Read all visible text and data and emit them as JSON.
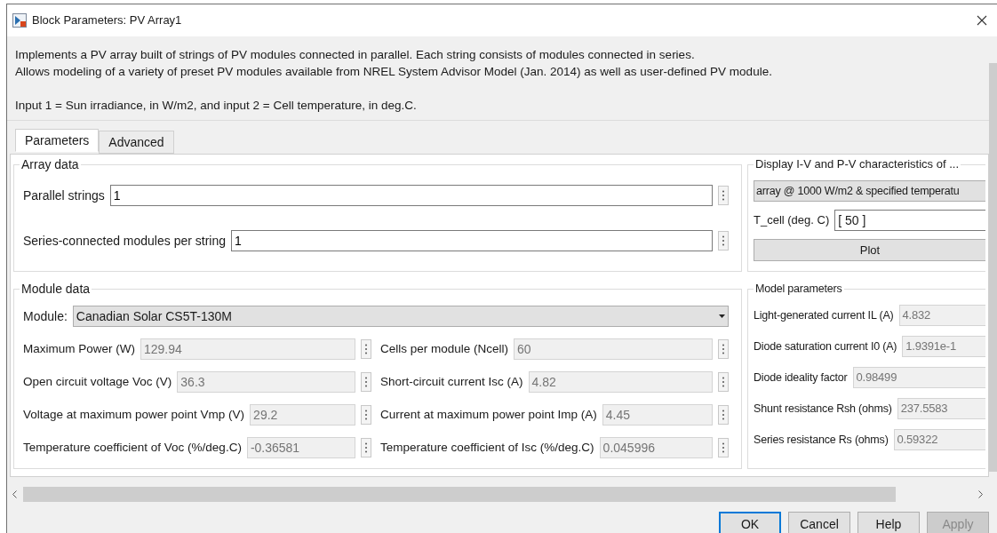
{
  "window": {
    "title": "Block Parameters: PV Array1"
  },
  "description": [
    "Implements a PV array built of strings of PV modules connected in parallel. Each string consists of modules connected in series.",
    "Allows modeling of a variety of preset PV modules available from NREL System Advisor Model (Jan. 2014) as well as user-defined PV module.",
    "Input 1 = Sun irradiance, in W/m2, and input 2 = Cell temperature, in deg.C."
  ],
  "tabs": [
    {
      "label": "Parameters",
      "selected": true
    },
    {
      "label": "Advanced",
      "selected": false
    }
  ],
  "array_data": {
    "title": "Array data",
    "fields": [
      {
        "label": "Parallel strings",
        "value": "1",
        "disabled": false
      },
      {
        "label": "Series-connected modules per string",
        "value": "1",
        "disabled": false
      }
    ]
  },
  "display": {
    "title": "Display  I-V and P-V characteristics of ...",
    "selection": "array @ 1000 W/m2 & specified temperatu",
    "t_cell_label": "T_cell (deg. C)",
    "t_cell_value": "[ 50 ]",
    "plot_button": "Plot"
  },
  "module_data": {
    "title": "Module data",
    "module_label": "Module:",
    "module_value": "Canadian Solar CS5T-130M",
    "rows": [
      [
        {
          "label": "Maximum Power (W)",
          "value": "129.94",
          "disabled": true
        },
        {
          "label": "Cells per module (Ncell)",
          "value": "60",
          "disabled": true
        }
      ],
      [
        {
          "label": "Open circuit voltage  Voc (V)",
          "value": "36.3",
          "disabled": true
        },
        {
          "label": "Short-circuit current Isc (A)",
          "value": "4.82",
          "disabled": true
        }
      ],
      [
        {
          "label": "Voltage at maximum power point Vmp (V)",
          "value": "29.2",
          "disabled": true
        },
        {
          "label": "Current at maximum power point Imp (A)",
          "value": "4.45",
          "disabled": true
        }
      ],
      [
        {
          "label": "Temperature coefficient of Voc (%/deg.C)",
          "value": "-0.36581",
          "disabled": true
        },
        {
          "label": "Temperature coefficient of Isc (%/deg.C)",
          "value": "0.045996",
          "disabled": true
        }
      ]
    ]
  },
  "model_parameters": {
    "title": "Model parameters",
    "fields": [
      {
        "label": "Light-generated current IL (A)",
        "value": "4.832",
        "disabled": true
      },
      {
        "label": "Diode saturation current I0 (A)",
        "value": "1.9391e-1",
        "disabled": true
      },
      {
        "label": "Diode ideality factor",
        "value": "0.98499",
        "disabled": true
      },
      {
        "label": "Shunt resistance Rsh (ohms)",
        "value": "237.5583",
        "disabled": true
      },
      {
        "label": "Series resistance Rs (ohms)",
        "value": "0.59322",
        "disabled": true
      }
    ]
  },
  "buttons": [
    {
      "label": "OK",
      "focused": true,
      "disabled": false
    },
    {
      "label": "Cancel",
      "focused": false,
      "disabled": false
    },
    {
      "label": "Help",
      "focused": false,
      "disabled": false
    },
    {
      "label": "Apply",
      "focused": false,
      "disabled": true
    }
  ]
}
